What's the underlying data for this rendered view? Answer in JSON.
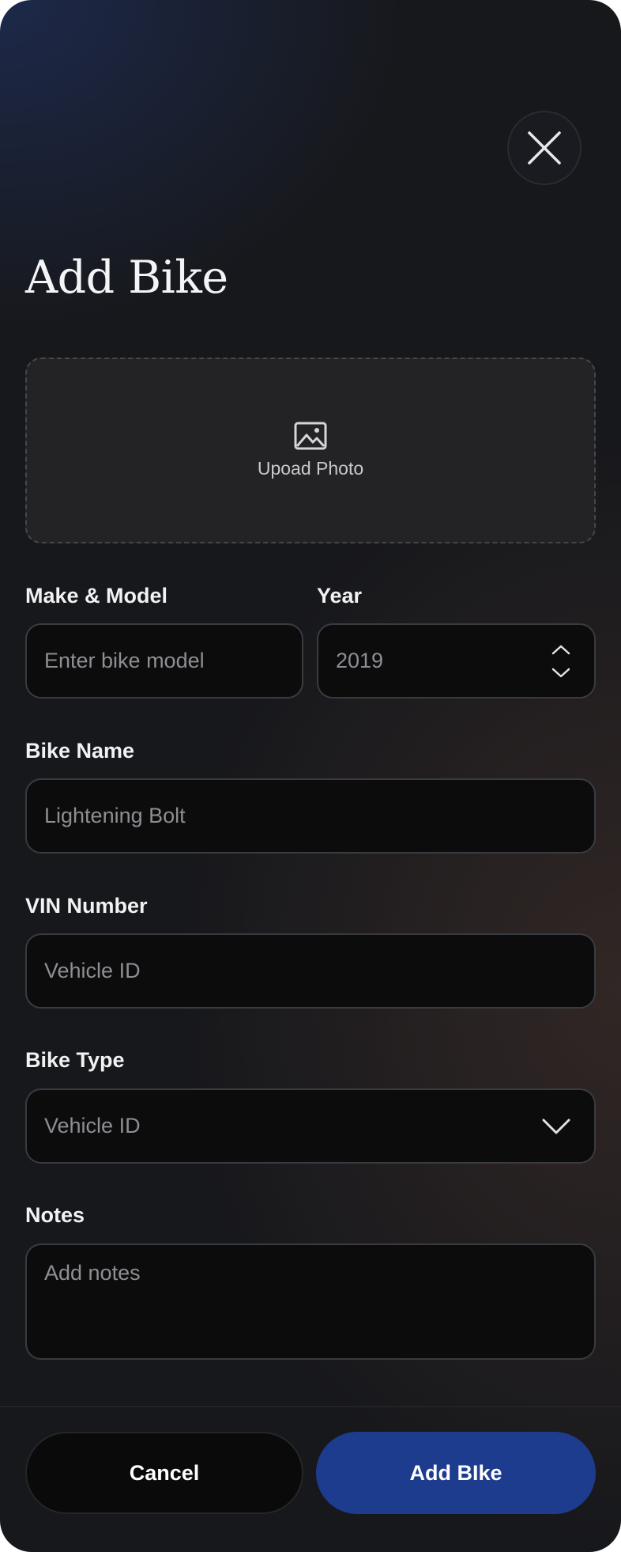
{
  "header": {
    "title": "Add Bike"
  },
  "upload": {
    "label": "Upoad Photo"
  },
  "form": {
    "make_model": {
      "label": "Make & Model",
      "placeholder": "Enter bike model"
    },
    "year": {
      "label": "Year",
      "value": "2019"
    },
    "bike_name": {
      "label": "Bike Name",
      "placeholder": "Lightening Bolt"
    },
    "vin": {
      "label": "VIN Number",
      "placeholder": "Vehicle ID"
    },
    "bike_type": {
      "label": "Bike Type",
      "selected": "Vehicle ID"
    },
    "notes": {
      "label": "Notes",
      "placeholder": "Add notes"
    }
  },
  "footer": {
    "cancel_label": "Cancel",
    "submit_label": "Add BIke"
  },
  "icons": {
    "close": "close-icon",
    "upload": "image-icon",
    "stepper": "chevron-up-down-icon",
    "dropdown": "chevron-down-icon"
  },
  "colors": {
    "primary": "#1d3c8e",
    "background": "#17181c",
    "input_background": "#0c0c0d"
  }
}
